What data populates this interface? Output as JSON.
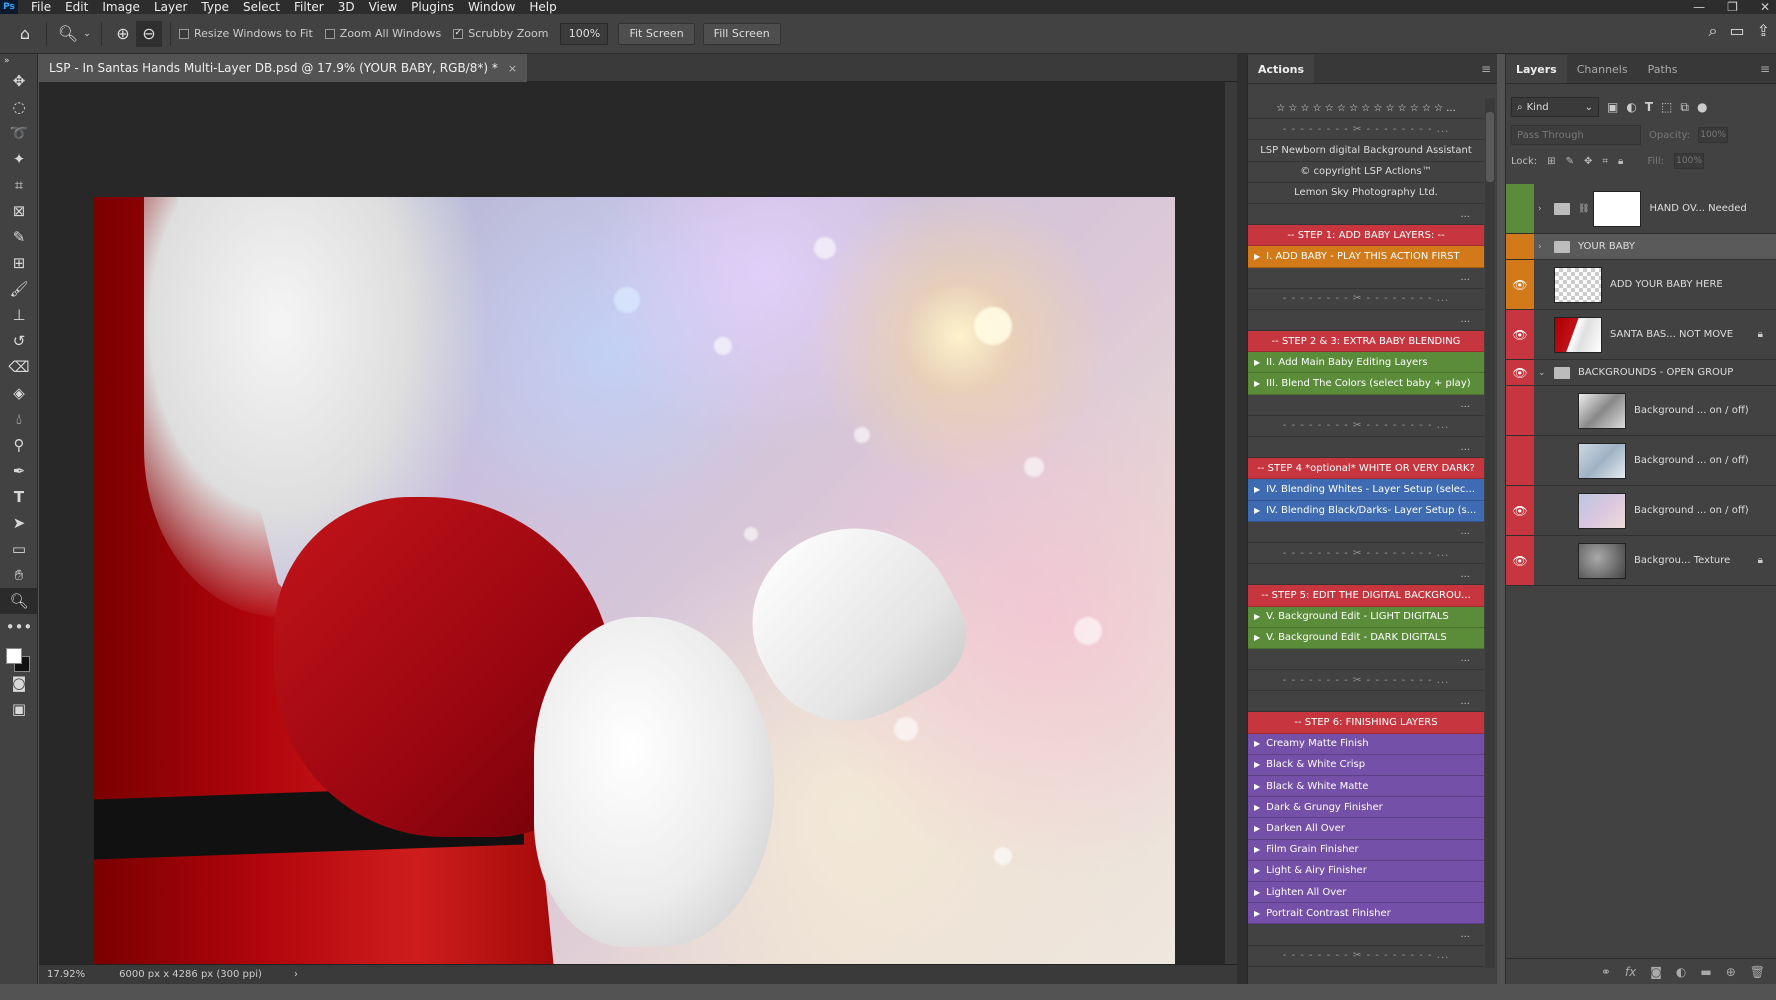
{
  "app": {
    "logo": "Ps"
  },
  "menu": [
    "File",
    "Edit",
    "Image",
    "Layer",
    "Type",
    "Select",
    "Filter",
    "3D",
    "View",
    "Plugins",
    "Window",
    "Help"
  ],
  "window_controls": {
    "minimize": "—",
    "restore": "❐",
    "close": "✕"
  },
  "options_bar": {
    "resize_windows": "Resize Windows to Fit",
    "zoom_all_windows": "Zoom All Windows",
    "scrubby_zoom": "Scrubby Zoom",
    "zoom_value": "100%",
    "fit_screen": "Fit Screen",
    "fill_screen": "Fill Screen",
    "resize_checked": false,
    "zoom_all_checked": false,
    "scrubby_checked": true
  },
  "document": {
    "tab_title": "LSP - In Santas Hands Multi-Layer DB.psd @ 17.9% (YOUR BABY, RGB/8*) *",
    "close": "×"
  },
  "status": {
    "zoom": "17.92%",
    "info": "6000 px x 4286 px (300 ppi)",
    "arrow": "›"
  },
  "actions_panel": {
    "tab": "Actions",
    "items": [
      {
        "text": "☆ ☆ ☆ ☆ ☆ ☆ ☆ ☆ ☆ ☆ ☆ ☆ ☆ ☆ ...",
        "style": "plain",
        "kind": "center"
      },
      {
        "text": "- - - - - - - - ✂ - - - - - - - - ...",
        "style": "plain",
        "kind": "sep"
      },
      {
        "text": "LSP Newborn digital Background Assistant",
        "style": "plain",
        "kind": "center"
      },
      {
        "text": "© copyright LSP Actions™",
        "style": "plain",
        "kind": "center"
      },
      {
        "text": "Lemon Sky Photography Ltd.",
        "style": "plain",
        "kind": "center"
      },
      {
        "text": "...",
        "style": "plain",
        "kind": "dots"
      },
      {
        "text": "-- STEP 1: ADD BABY LAYERS: --",
        "style": "red",
        "kind": "center"
      },
      {
        "text": "I. ADD BABY - PLAY THIS ACTION FIRST",
        "style": "orange",
        "kind": "action"
      },
      {
        "text": "...",
        "style": "plain",
        "kind": "dots"
      },
      {
        "text": "- - - - - - - - ✂ - - - - - - - - ...",
        "style": "plain",
        "kind": "sep"
      },
      {
        "text": "...",
        "style": "plain",
        "kind": "dots"
      },
      {
        "text": "-- STEP 2 & 3: EXTRA BABY BLENDING",
        "style": "red",
        "kind": "center"
      },
      {
        "text": "II.  Add Main Baby Editing Layers",
        "style": "green",
        "kind": "action"
      },
      {
        "text": "III. Blend The Colors (select baby + play)",
        "style": "green",
        "kind": "action"
      },
      {
        "text": "...",
        "style": "plain",
        "kind": "dots"
      },
      {
        "text": "- - - - - - - - ✂ - - - - - - - - ...",
        "style": "plain",
        "kind": "sep"
      },
      {
        "text": "...",
        "style": "plain",
        "kind": "dots"
      },
      {
        "text": "-- STEP 4 *optional* WHITE OR VERY DARK?",
        "style": "red",
        "kind": "center"
      },
      {
        "text": "IV. Blending Whites - Layer Setup (selec...",
        "style": "blue",
        "kind": "action"
      },
      {
        "text": "IV. Blending Black/Darks- Layer Setup (s...",
        "style": "blue",
        "kind": "action"
      },
      {
        "text": "...",
        "style": "plain",
        "kind": "dots"
      },
      {
        "text": "- - - - - - - - ✂ - - - - - - - - ...",
        "style": "plain",
        "kind": "sep"
      },
      {
        "text": "...",
        "style": "plain",
        "kind": "dots"
      },
      {
        "text": "-- STEP 5: EDIT THE DIGITAL BACKGROU...",
        "style": "red",
        "kind": "center"
      },
      {
        "text": "V. Background Edit - LIGHT DIGITALS",
        "style": "green",
        "kind": "action"
      },
      {
        "text": "V. Background Edit - DARK DIGITALS",
        "style": "green",
        "kind": "action"
      },
      {
        "text": "...",
        "style": "plain",
        "kind": "dots"
      },
      {
        "text": "- - - - - - - - ✂ - - - - - - - - ...",
        "style": "plain",
        "kind": "sep"
      },
      {
        "text": "...",
        "style": "plain",
        "kind": "dots"
      },
      {
        "text": "-- STEP 6: FINISHING LAYERS",
        "style": "red",
        "kind": "center"
      },
      {
        "text": "Creamy Matte Finish",
        "style": "violet",
        "kind": "action"
      },
      {
        "text": "Black & White Crisp",
        "style": "violet",
        "kind": "action"
      },
      {
        "text": "Black & White Matte",
        "style": "violet",
        "kind": "action"
      },
      {
        "text": "Dark & Grungy Finisher",
        "style": "violet",
        "kind": "action"
      },
      {
        "text": "Darken All Over",
        "style": "violet",
        "kind": "action"
      },
      {
        "text": "Film Grain Finisher",
        "style": "violet",
        "kind": "action"
      },
      {
        "text": "Light & Airy Finisher",
        "style": "violet",
        "kind": "action"
      },
      {
        "text": "Lighten All Over",
        "style": "violet",
        "kind": "action"
      },
      {
        "text": "Portrait Contrast Finisher",
        "style": "violet",
        "kind": "action"
      },
      {
        "text": "...",
        "style": "plain",
        "kind": "dots"
      },
      {
        "text": "- - - - - - - - ✂ - - - - - - - - ...",
        "style": "plain",
        "kind": "sep"
      },
      {
        "text": "...",
        "style": "plain",
        "kind": "dots"
      }
    ]
  },
  "layers_panel": {
    "tabs": [
      "Layers",
      "Channels",
      "Paths"
    ],
    "kind": "Kind",
    "blend_mode": "Pass Through",
    "opacity_label": "Opacity:",
    "opacity_value": "100%",
    "lock_label": "Lock:",
    "fill_label": "Fill:",
    "fill_value": "100%",
    "layers": [
      {
        "name": "HAND OV... Needed",
        "eye": "green",
        "visible": false,
        "type": "group-mask",
        "expander": "›",
        "locked": false
      },
      {
        "name": "YOUR BABY",
        "eye": "orange",
        "visible": false,
        "type": "group",
        "expander": "›",
        "locked": false,
        "selected": true
      },
      {
        "name": "ADD YOUR BABY HERE",
        "eye": "orange",
        "visible": true,
        "type": "transparent",
        "expander": "",
        "locked": false
      },
      {
        "name": "SANTA BAS... NOT MOVE",
        "eye": "red",
        "visible": true,
        "type": "santa",
        "expander": "",
        "locked": true
      },
      {
        "name": "BACKGROUNDS - OPEN GROUP",
        "eye": "red",
        "visible": true,
        "type": "group",
        "expander": "⌄",
        "locked": false
      },
      {
        "name": "Background ... on / off)",
        "eye": "red",
        "visible": false,
        "type": "bg1",
        "expander": "",
        "locked": false,
        "indent": true
      },
      {
        "name": "Background ... on / off)",
        "eye": "red",
        "visible": false,
        "type": "bg2",
        "expander": "",
        "locked": false,
        "indent": true
      },
      {
        "name": "Background ... on / off)",
        "eye": "red",
        "visible": true,
        "type": "bg3",
        "expander": "",
        "locked": false,
        "indent": true
      },
      {
        "name": "Backgrou... Texture",
        "eye": "red",
        "visible": true,
        "type": "texture",
        "expander": "",
        "locked": true,
        "indent": true
      }
    ]
  }
}
